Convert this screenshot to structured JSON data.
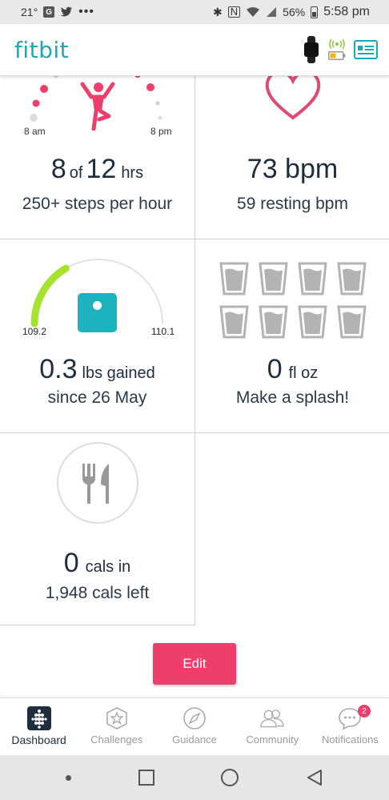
{
  "status_bar": {
    "temperature": "21°",
    "battery_percent": "56%",
    "time": "5:58 pm"
  },
  "app": {
    "logo": "fitbit"
  },
  "tiles": {
    "hourly": {
      "start_label": "8 am",
      "end_label": "8 pm",
      "value": "8",
      "of_label": "of",
      "target": "12",
      "unit": "hrs",
      "subtitle": "250+ steps per hour"
    },
    "heart": {
      "value": "73 bpm",
      "subtitle": "59 resting bpm"
    },
    "weight": {
      "start_value": "109.2",
      "end_value": "110.1",
      "value": "0.3",
      "unit": "lbs gained",
      "subtitle": "since 26 May",
      "progress_fraction": 0.33
    },
    "water": {
      "value": "0",
      "unit": "fl oz",
      "subtitle": "Make a splash!",
      "glasses_filled": 0,
      "glasses_total": 8
    },
    "food": {
      "value": "0",
      "unit": "cals in",
      "subtitle": "1,948 cals left"
    }
  },
  "edit_label": "Edit",
  "nav": {
    "items": [
      {
        "label": "Dashboard",
        "icon": "dashboard-dots-icon",
        "active": true
      },
      {
        "label": "Challenges",
        "icon": "star-badge-icon"
      },
      {
        "label": "Guidance",
        "icon": "compass-icon"
      },
      {
        "label": "Community",
        "icon": "people-icon"
      },
      {
        "label": "Notifications",
        "icon": "chat-bubble-icon"
      }
    ],
    "notifications_count": "2"
  },
  "colors": {
    "brand": "#17a9b8",
    "accent_pink": "#ee3e6c",
    "weight_green": "#a6e22e",
    "scale_teal": "#1cb3bf"
  }
}
